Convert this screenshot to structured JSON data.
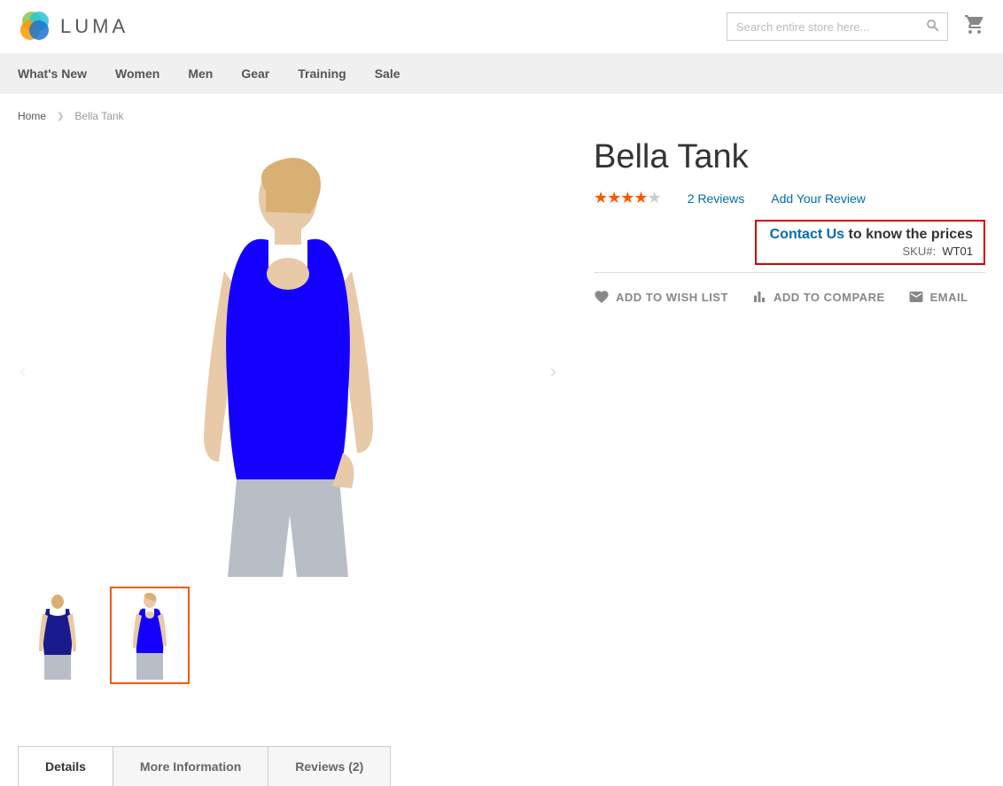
{
  "header": {
    "logo_text": "LUMA",
    "search_placeholder": "Search entire store here..."
  },
  "nav": {
    "items": [
      "What's New",
      "Women",
      "Men",
      "Gear",
      "Training",
      "Sale"
    ]
  },
  "breadcrumbs": {
    "home": "Home",
    "current": "Bella Tank"
  },
  "product": {
    "title": "Bella Tank",
    "rating_stars": 4,
    "rating_max": 5,
    "reviews_label": "2 Reviews",
    "add_review_label": "Add Your Review",
    "contact_label": "Contact Us",
    "know_prices_label": " to know the prices",
    "sku_label": "SKU#:",
    "sku_value": "WT01",
    "actions": {
      "wishlist": "ADD TO WISH LIST",
      "compare": "ADD TO COMPARE",
      "email": "EMAIL"
    }
  },
  "tabs": {
    "details": "Details",
    "more_info": "More Information",
    "reviews": "Reviews (2)"
  }
}
